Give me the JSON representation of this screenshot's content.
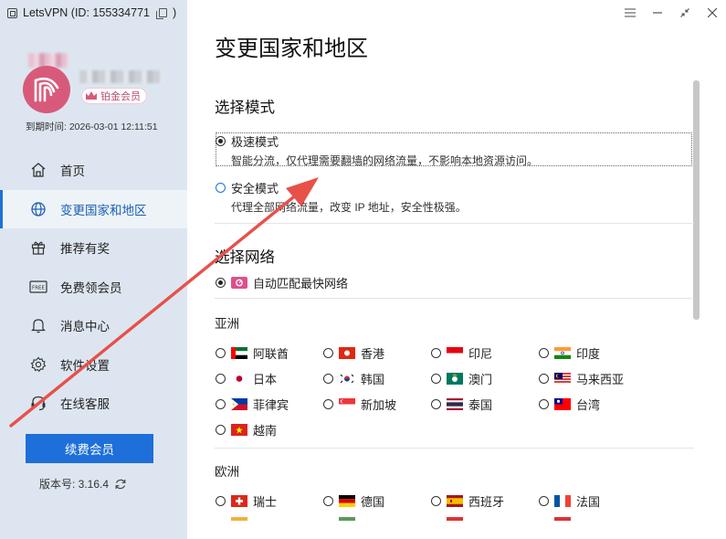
{
  "window": {
    "title": "LetsVPN (ID: 155334771",
    "title_suffix": ")"
  },
  "profile": {
    "vip_label": "铂金会员",
    "expire_text": "到期时间: 2026-03-01 12:11:51"
  },
  "nav": {
    "items": [
      {
        "label": "首页",
        "icon": "home-icon"
      },
      {
        "label": "变更国家和地区",
        "icon": "globe-icon",
        "active": true
      },
      {
        "label": "推荐有奖",
        "icon": "gift-icon"
      },
      {
        "label": "免费领会员",
        "icon": "free-ticket-icon"
      },
      {
        "label": "消息中心",
        "icon": "bell-icon"
      },
      {
        "label": "软件设置",
        "icon": "gear-icon"
      },
      {
        "label": "在线客服",
        "icon": "headset-icon"
      }
    ]
  },
  "footer": {
    "renew_label": "续费会员",
    "version_text": "版本号:   3.16.4"
  },
  "main": {
    "page_title": "变更国家和地区",
    "mode_section_title": "选择模式",
    "modes": [
      {
        "label": "极速模式",
        "desc": "智能分流，仅代理需要翻墙的网络流量，不影响本地资源访问。",
        "selected": true
      },
      {
        "label": "安全模式",
        "desc": "代理全部网络流量，改变 IP 地址，安全性极强。",
        "selected": false
      }
    ],
    "network_section_title": "选择网络",
    "auto_option": "自动匹配最快网络",
    "regions": [
      {
        "name": "亚洲",
        "countries": [
          "阿联酋",
          "香港",
          "印尼",
          "印度",
          "日本",
          "韩国",
          "澳门",
          "马来西亚",
          "菲律宾",
          "新加坡",
          "泰国",
          "台湾",
          "越南"
        ]
      },
      {
        "name": "欧洲",
        "countries": [
          "瑞士",
          "德国",
          "西班牙",
          "法国"
        ]
      }
    ]
  },
  "colors": {
    "accent": "#1e6fd9",
    "sidebar_bg": "#dde6f0",
    "arrow": "#e8504a",
    "vip_pink": "#d85a7a"
  }
}
